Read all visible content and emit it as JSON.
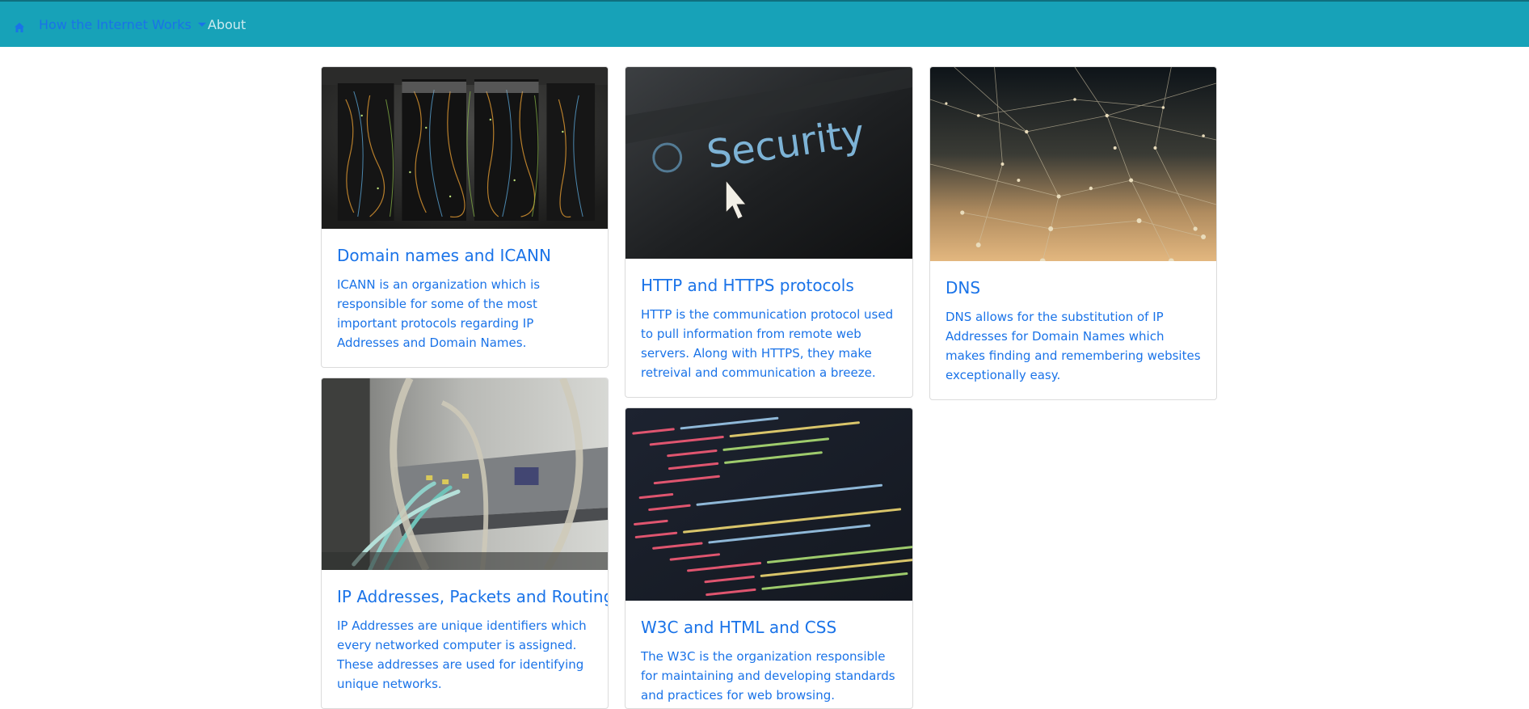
{
  "nav": {
    "brand_icon": "house-icon",
    "dropdown_label": "How the Internet Works",
    "about_label": "About",
    "bar_color": "#17a2b8",
    "link_color": "#1a73e8"
  },
  "cards": [
    {
      "title": "Domain names and ICANN",
      "text": "ICANN is an organization which is responsible for some of the most important protocols regarding IP Addresses and Domain Names.",
      "image": "server-rack-photo"
    },
    {
      "title": "HTTP and HTTPS protocols",
      "text": "HTTP is the communication protocol used to pull information from remote web servers. Along with HTTPS, they make retreival and communication a breeze.",
      "image": "security-screen-photo",
      "image_text": "Security"
    },
    {
      "title": "DNS",
      "text": "DNS allows for the substitution of IP Addresses for Domain Names which makes finding and remembering websites exceptionally easy.",
      "image": "dewy-spider-web-photo"
    },
    {
      "title": "IP Addresses, Packets and Routing",
      "text": "IP Addresses are unique identifiers which every networked computer is assigned. These addresses are used for identifying unique networks.",
      "image": "network-switch-cables-photo"
    },
    {
      "title": "W3C and HTML and CSS",
      "text": "The W3C is the organization responsible for maintaining and developing standards and practices for web browsing.",
      "image": "html-code-screen-photo"
    }
  ]
}
